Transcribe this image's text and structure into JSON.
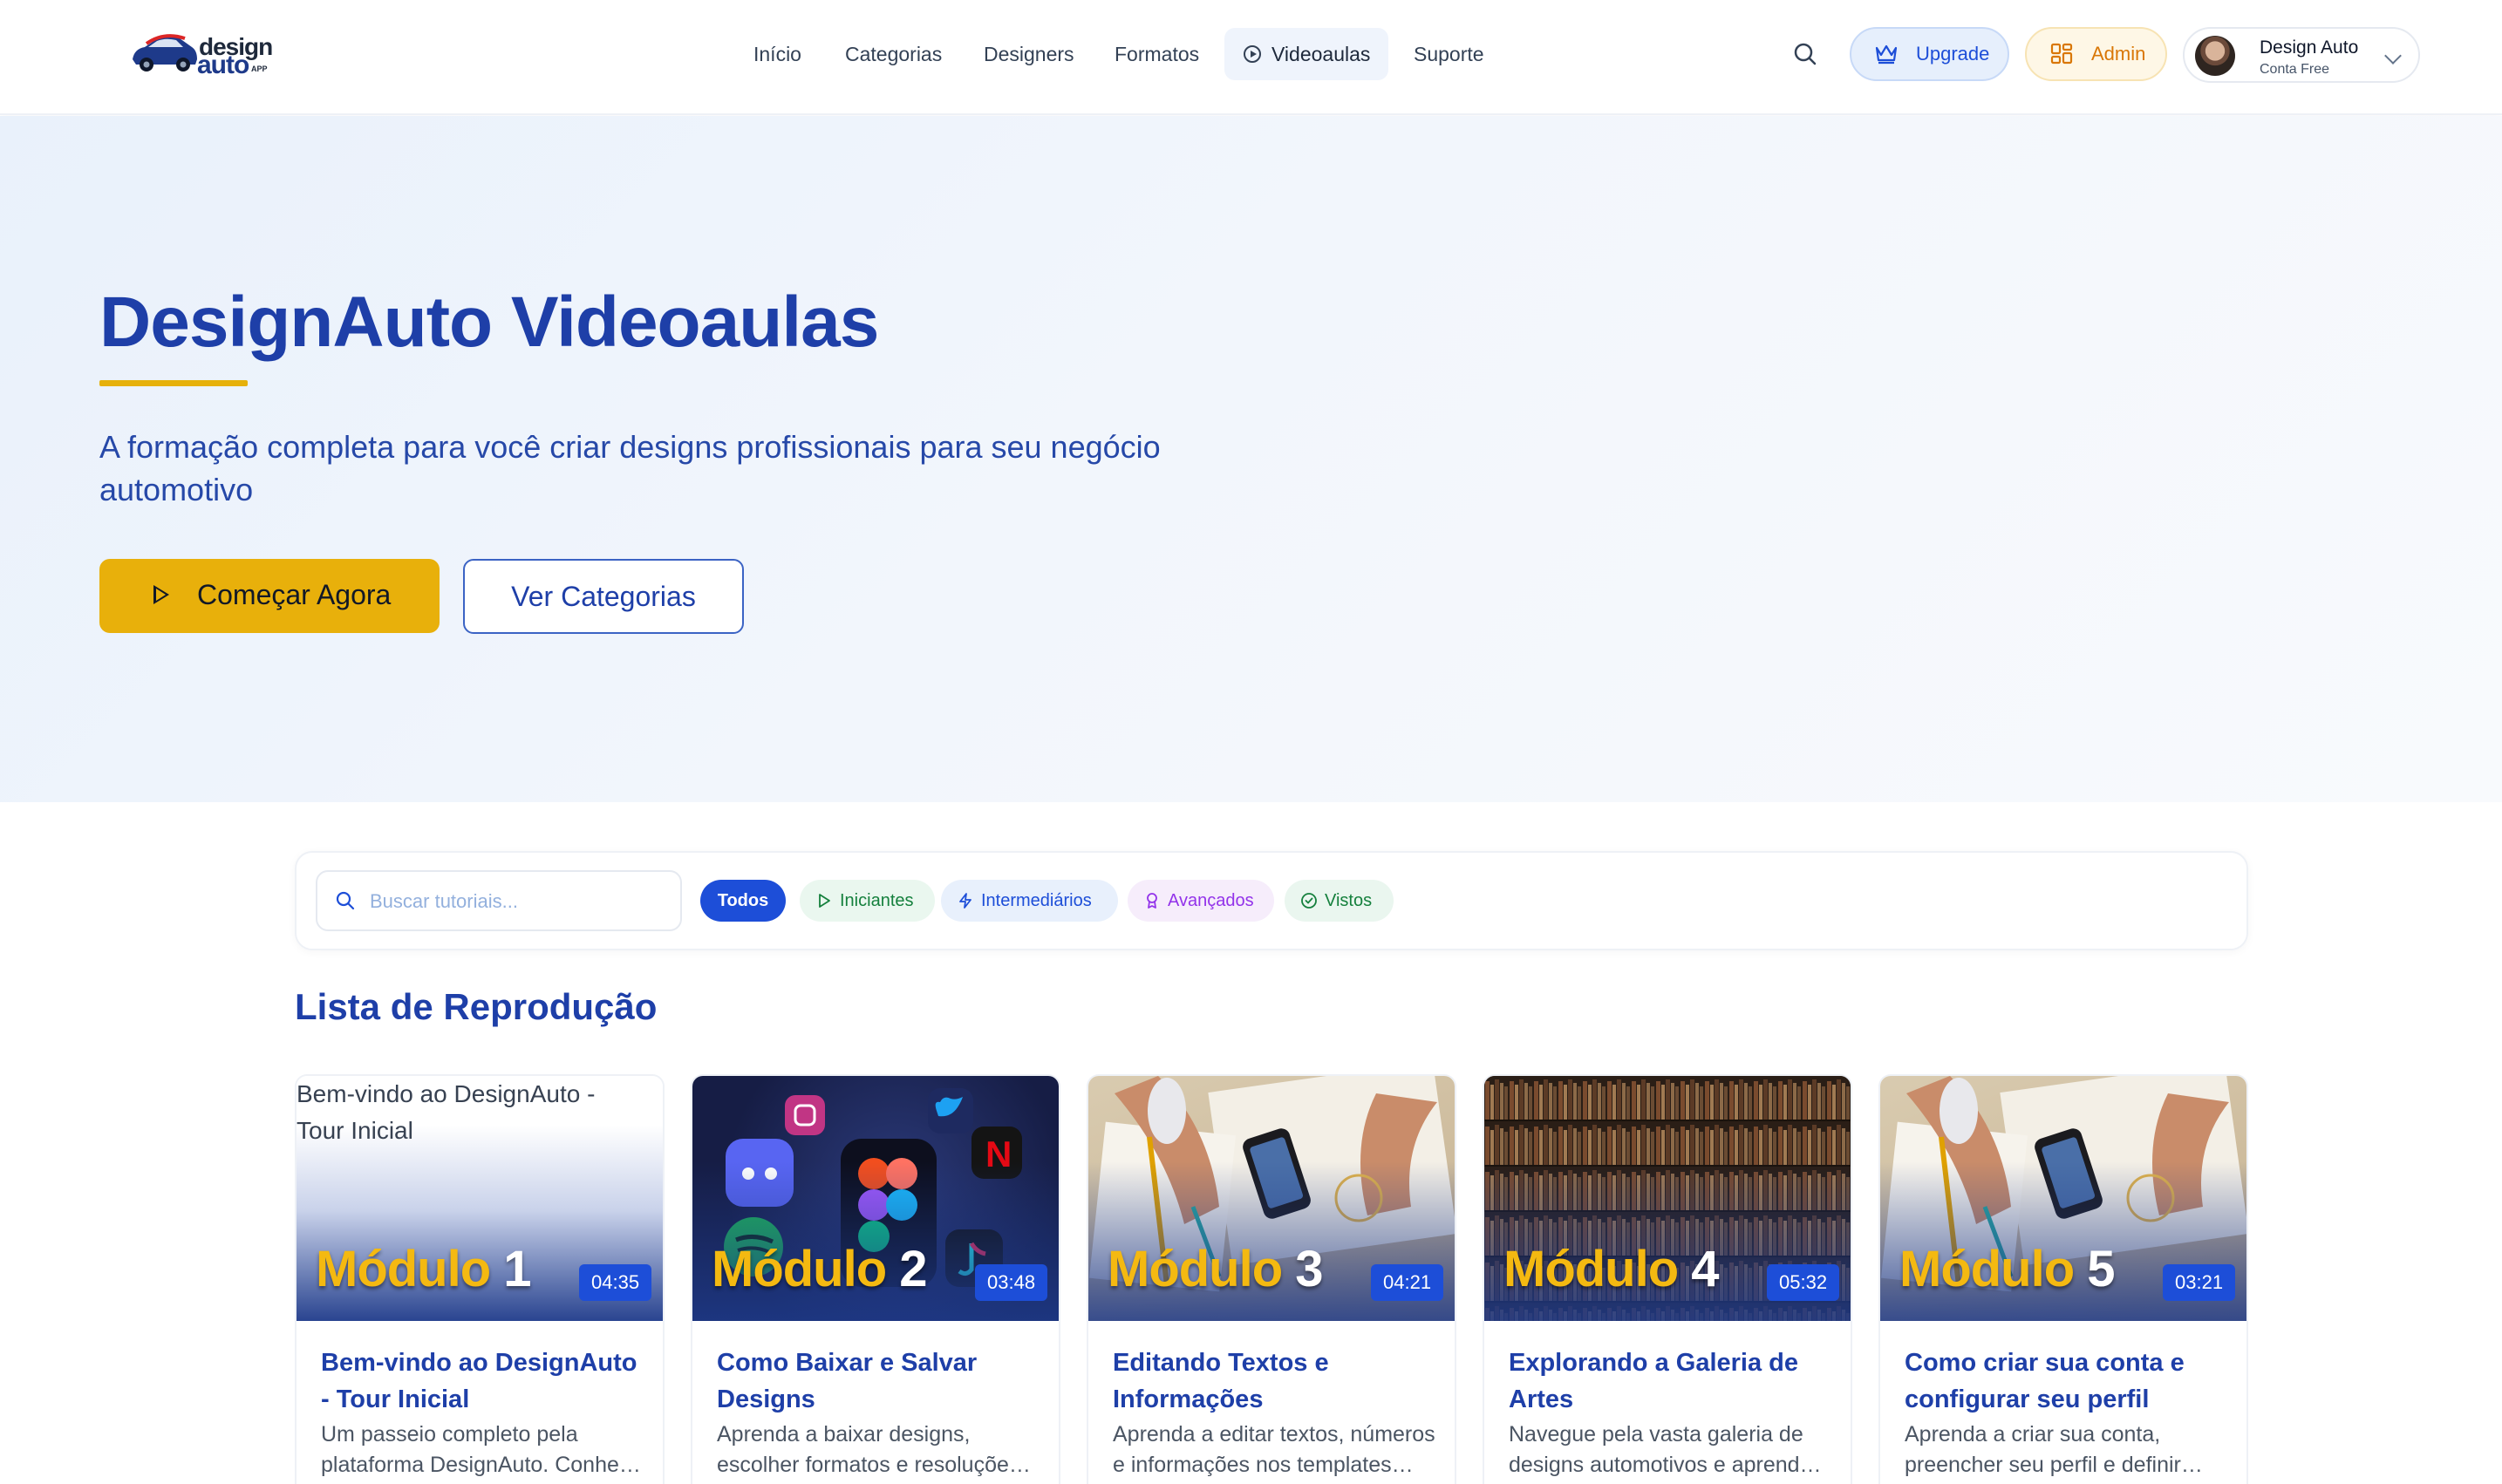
{
  "app": {
    "logo_line1": "design",
    "logo_line2": "auto",
    "logo_tag": "APP"
  },
  "nav": {
    "items": [
      {
        "label": "Início"
      },
      {
        "label": "Categorias"
      },
      {
        "label": "Designers"
      },
      {
        "label": "Formatos"
      },
      {
        "label": "Videoaulas",
        "active": true
      },
      {
        "label": "Suporte"
      }
    ]
  },
  "header": {
    "upgrade_label": "Upgrade",
    "admin_label": "Admin",
    "user_name": "Design Auto",
    "user_plan": "Conta Free"
  },
  "hero": {
    "title": "DesignAuto Videoaulas",
    "subtitle": "A formação completa para você criar designs profissionais para seu negócio automotivo",
    "primary_button": "Começar Agora",
    "secondary_button": "Ver Categorias"
  },
  "filters": {
    "search_placeholder": "Buscar tutoriais...",
    "chips": [
      {
        "label": "Todos",
        "active": true
      },
      {
        "label": "Iniciantes"
      },
      {
        "label": "Intermediários"
      },
      {
        "label": "Avançados"
      },
      {
        "label": "Vistos"
      }
    ]
  },
  "playlist": {
    "title": "Lista de Reprodução",
    "module_word": "Módulo",
    "cards": [
      {
        "thumb_alt": "Bem-vindo ao DesignAuto - Tour Inicial",
        "module_number": "1",
        "duration": "04:35",
        "title": "Bem-vindo ao DesignAuto - Tour Inicial",
        "description": "Um passeio completo pela plataforma DesignAuto. Conheça todos os recursos"
      },
      {
        "module_number": "2",
        "duration": "03:48",
        "title": "Como Baixar e Salvar Designs",
        "description": "Aprenda a baixar designs, escolher formatos e resoluções ideais"
      },
      {
        "module_number": "3",
        "duration": "04:21",
        "title": "Editando Textos e Informações",
        "description": "Aprenda a editar textos, números e informações nos templates para seu negócio"
      },
      {
        "module_number": "4",
        "duration": "05:32",
        "title": "Explorando a Galeria de Artes",
        "description": "Navegue pela vasta galeria de designs automotivos e aprenda a encontrar"
      },
      {
        "module_number": "5",
        "duration": "03:21",
        "title": "Como criar sua conta e configurar seu perfil",
        "description": "Aprenda a criar sua conta, preencher seu perfil e definir suas preferências"
      }
    ]
  },
  "colors": {
    "brand_blue": "#1e3fa8",
    "accent_yellow": "#e8b00b",
    "chip_active": "#1d4ed8"
  }
}
